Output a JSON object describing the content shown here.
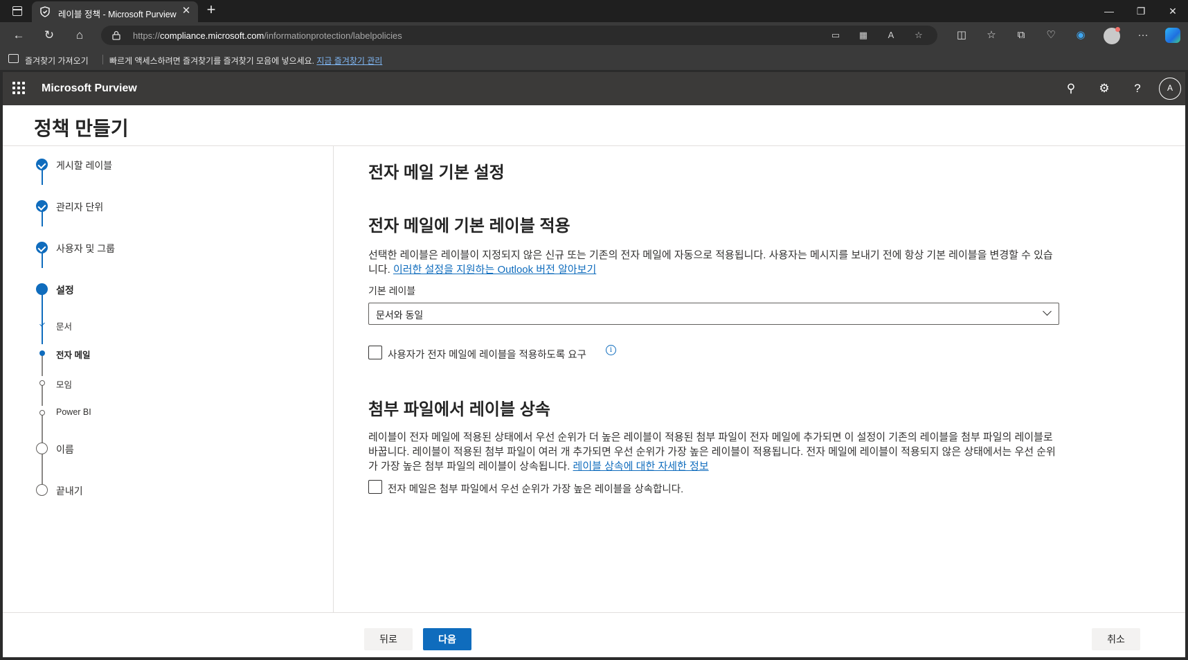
{
  "browser": {
    "tab_title": "레이블 정책 - Microsoft Purview",
    "url_prefix": "https://",
    "url_domain": "compliance.microsoft.com",
    "url_path": "/informationprotection/labelpolicies",
    "favorites_import": "즐겨찾기 가져오기",
    "favorites_hint": "빠르게 액세스하려면 즐겨찾기를 즐겨찾기 모음에 넣으세요.",
    "favorites_manage_link": "지금 즐겨찾기 관리"
  },
  "suite": {
    "brand": "Microsoft Purview",
    "avatar_initial": "A"
  },
  "page": {
    "title": "정책 만들기"
  },
  "steps": [
    {
      "label": "게시할 레이블",
      "state": "done"
    },
    {
      "label": "관리자 단위",
      "state": "done"
    },
    {
      "label": "사용자 및 그룹",
      "state": "done"
    },
    {
      "label": "설정",
      "state": "current"
    },
    {
      "label": "이름",
      "state": "todo"
    },
    {
      "label": "끝내기",
      "state": "todo"
    }
  ],
  "substeps": [
    {
      "label": "문서",
      "state": "done"
    },
    {
      "label": "전자 메일",
      "state": "current"
    },
    {
      "label": "모임",
      "state": "todo"
    },
    {
      "label": "Power BI",
      "state": "todo"
    }
  ],
  "main": {
    "heading": "전자 메일 기본 설정",
    "section1": {
      "heading": "전자 메일에 기본 레이블 적용",
      "description": "선택한 레이블은 레이블이 지정되지 않은 신규 또는 기존의 전자 메일에 자동으로 적용됩니다. 사용자는 메시지를 보내기 전에 항상 기본 레이블을 변경할 수 있습니다. ",
      "link": "이러한 설정을 지원하는 Outlook 버전 알아보기",
      "field_label": "기본 레이블",
      "dropdown_value": "문서와 동일",
      "checkbox_label": "사용자가 전자 메일에 레이블을 적용하도록 요구",
      "checkbox_checked": false
    },
    "section2": {
      "heading": "첨부 파일에서 레이블 상속",
      "description": "레이블이 전자 메일에 적용된 상태에서 우선 순위가 더 높은 레이블이 적용된 첨부 파일이 전자 메일에 추가되면 이 설정이 기존의 레이블을 첨부 파일의 레이블로 바꿉니다. 레이블이 적용된 첨부 파일이 여러 개 추가되면 우선 순위가 가장 높은 레이블이 적용됩니다. 전자 메일에 레이블이 적용되지 않은 상태에서는 우선 순위가 가장 높은 첨부 파일의 레이블이 상속됩니다. ",
      "link": "레이블 상속에 대한 자세한 정보",
      "checkbox_label": "전자 메일은 첨부 파일에서 우선 순위가 가장 높은 레이블을 상속합니다.",
      "checkbox_checked": false
    }
  },
  "footer": {
    "back": "뒤로",
    "next": "다음",
    "cancel": "취소"
  },
  "colors": {
    "accent": "#0f6cbd",
    "suitebar": "#3b3a39"
  }
}
